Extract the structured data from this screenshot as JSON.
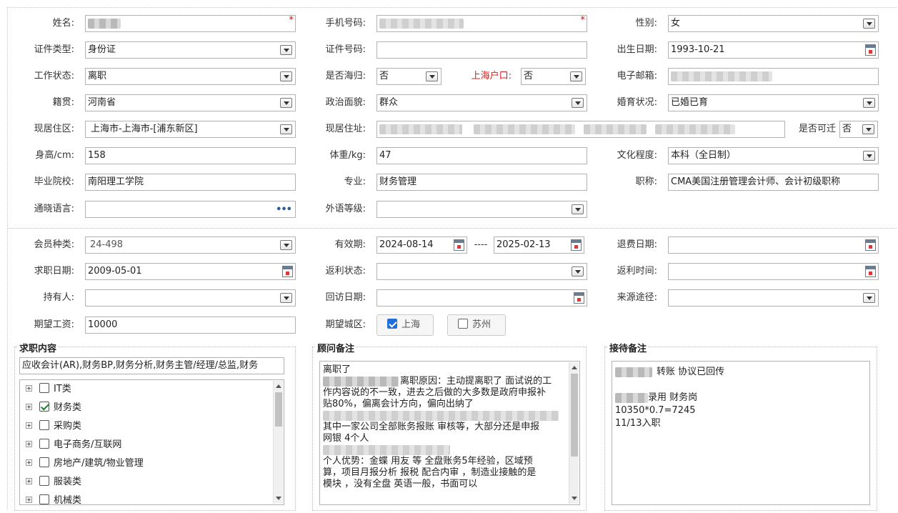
{
  "personal": {
    "name_label": "姓名:",
    "phone_label": "手机号码:",
    "gender_label": "性别:",
    "gender_value": "女",
    "id_type_label": "证件类型:",
    "id_type_value": "身份证",
    "id_number_label": "证件号码:",
    "id_number_value": "",
    "birth_label": "出生日期:",
    "birth_value": "1993-10-21",
    "work_status_label": "工作状态:",
    "work_status_value": "离职",
    "returnee_label": "是否海归:",
    "returnee_value": "否",
    "hukou_label": "上海户口:",
    "hukou_value": "否",
    "email_label": "电子邮箱:",
    "native_label": "籍贯:",
    "native_value": "河南省",
    "political_label": "政治面貌:",
    "political_value": "群众",
    "marital_label": "婚育状况:",
    "marital_value": "已婚已育",
    "residence_area_label": "现居住区:",
    "residence_area_value": "上海市-上海市-[浦东新区]",
    "address_label": "现居住址:",
    "relocate_label": "是否可迁",
    "relocate_value": "否",
    "height_label": "身高/cm:",
    "height_value": "158",
    "weight_label": "体重/kg:",
    "weight_value": "47",
    "education_label": "文化程度:",
    "education_value": "本科（全日制）",
    "school_label": "毕业院校:",
    "school_value": "南阳理工学院",
    "major_label": "专业:",
    "major_value": "财务管理",
    "title_label": "职称:",
    "title_value": "CMA美国注册管理会计师、会计初级职称",
    "language_label": "通晓语言:",
    "language_value": "",
    "foreign_level_label": "外语等级:",
    "foreign_level_value": ""
  },
  "membership": {
    "member_type_label": "会员种类:",
    "member_type_value": "24-498",
    "valid_label": "有效期:",
    "valid_from": "2024-08-14",
    "valid_sep": "----",
    "valid_to": "2025-02-13",
    "refund_date_label": "退费日期:",
    "refund_date_value": "",
    "apply_date_label": "求职日期:",
    "apply_date_value": "2009-05-01",
    "rebate_status_label": "返利状态:",
    "rebate_status_value": "",
    "rebate_time_label": "返利时间:",
    "rebate_time_value": "",
    "holder_label": "持有人:",
    "holder_value": "",
    "visit_date_label": "回访日期:",
    "visit_date_value": "",
    "source_label": "来源途径:",
    "source_value": "",
    "salary_label": "期望工资:",
    "salary_value": "10000",
    "city_label": "期望城区:",
    "city_options": [
      {
        "label": "上海",
        "checked": true
      },
      {
        "label": "苏州",
        "checked": false
      }
    ]
  },
  "job_content": {
    "title": "求职内容",
    "summary": "应收会计(AR),财务BP,财务分析,财务主管/经理/总监,财务",
    "tree": [
      {
        "label": "IT类",
        "checked": false
      },
      {
        "label": "财务类",
        "checked": true
      },
      {
        "label": "采购类",
        "checked": false
      },
      {
        "label": "电子商务/互联网",
        "checked": false
      },
      {
        "label": "房地产/建筑/物业管理",
        "checked": false
      },
      {
        "label": "服装类",
        "checked": false
      },
      {
        "label": "机械类",
        "checked": false
      }
    ]
  },
  "consultant_notes": {
    "title": "顾问备注",
    "lines": [
      "离职了",
      "离职原因：主动提离职了 面试说的工",
      "作内容说的不一致，进去之后做的大多数是政府申报补",
      "贴80%，偏离会计方向，偏向出纳了",
      "",
      "其中一家公司全部账务报账  审核等，大部分还是申报",
      "网银 4个人",
      "",
      "个人优势：金蝶 用友 等 全盘账务5年经验，区域预",
      "算，项目月报分析 报税 配合内审 ，制造业接触的是",
      "模块 ，没有全盘 英语一般，书面可以"
    ]
  },
  "reception_notes": {
    "title": "接待备注",
    "lines": [
      "转账 协议已回传",
      "",
      "录用 财务岗",
      "10350*0.7=7245",
      "11/13入职"
    ]
  },
  "icons": {
    "dropdown": "chevron-down-icon",
    "calendar": "calendar-icon",
    "more": "ellipsis-icon",
    "required": "asterisk-icon"
  },
  "colors": {
    "required": "#dd0000",
    "highlight_label": "#d42020",
    "check_blue": "#1e6fd9"
  }
}
